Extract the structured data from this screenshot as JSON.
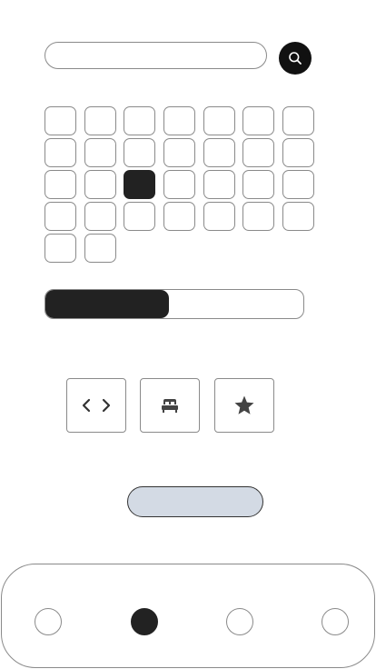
{
  "search": {
    "value": "",
    "placeholder": ""
  },
  "search_button": {
    "icon": "search-icon"
  },
  "calendar": {
    "day_count": 30,
    "selected_index": 16
  },
  "progress": {
    "value": 0.48
  },
  "actions": [
    {
      "icon": "code-icon"
    },
    {
      "icon": "bed-icon"
    },
    {
      "icon": "star-icon"
    }
  ],
  "primary_button": {
    "label": ""
  },
  "bottom_nav": {
    "item_count": 4,
    "active_index": 1
  },
  "colors": {
    "dark": "#222222",
    "button_fill": "#d3dae4",
    "border": "#8a8a8a"
  }
}
